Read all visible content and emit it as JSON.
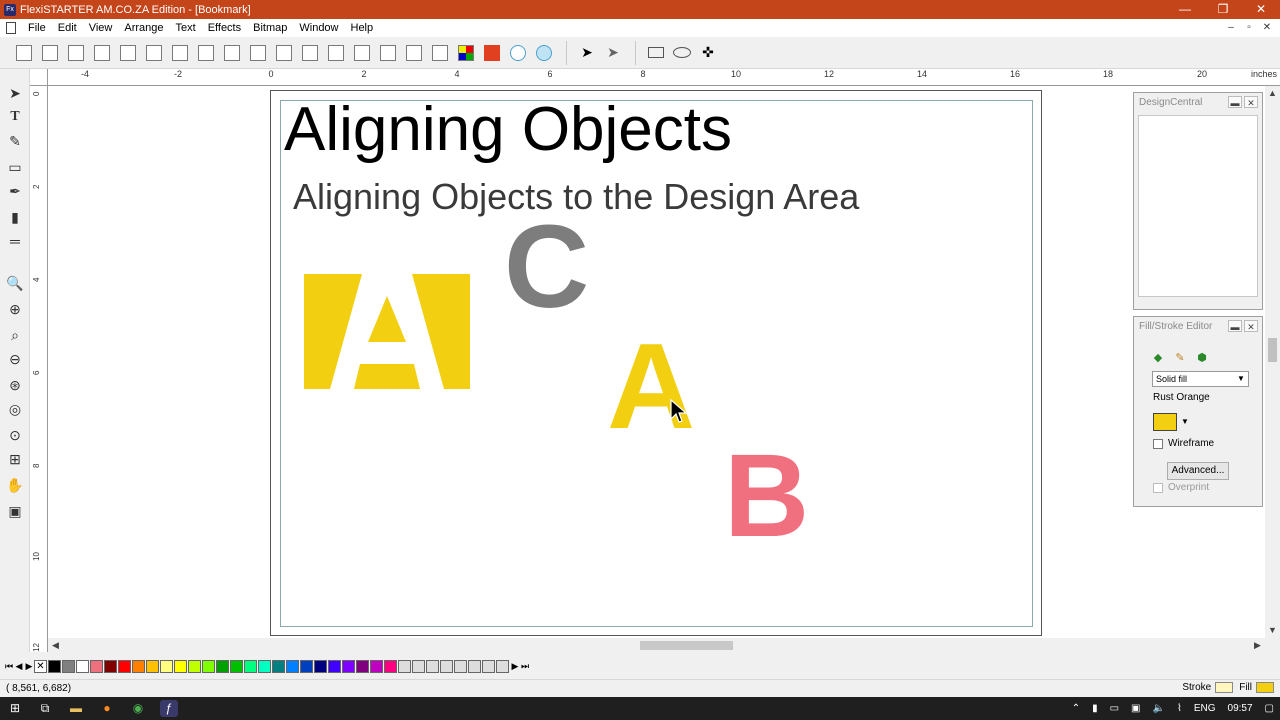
{
  "window": {
    "title": "FlexiSTARTER AM.CO.ZA Edition - [Bookmark]",
    "app_icon_text": "Fx",
    "minimize": "—",
    "maximize": "❐",
    "close": "✕"
  },
  "menu": {
    "items": [
      "File",
      "Edit",
      "View",
      "Arrange",
      "Text",
      "Effects",
      "Bitmap",
      "Window",
      "Help"
    ],
    "mdi_minimize": "–",
    "mdi_restore": "▫",
    "mdi_close": "✕"
  },
  "ruler": {
    "top_labels": [
      "-4",
      "-2",
      "0",
      "2",
      "4",
      "6",
      "8",
      "10",
      "12",
      "14",
      "16",
      "18",
      "20"
    ],
    "unit": "inches",
    "left_labels": [
      "0",
      "2",
      "4",
      "6",
      "8",
      "10",
      "12"
    ]
  },
  "canvas": {
    "heading": "Aligning Objects",
    "subheading": "Aligning Objects to the Design Area",
    "letters": [
      {
        "name": "letter-a-large",
        "text": "A",
        "color": "#f2cf10"
      },
      {
        "name": "letter-c",
        "text": "C",
        "color": "#7d7d7d"
      },
      {
        "name": "letter-a-small",
        "text": "A",
        "color": "#f2cf10"
      },
      {
        "name": "letter-b",
        "text": "B",
        "color": "#f07080"
      }
    ]
  },
  "design_central": {
    "title": "DesignCentral"
  },
  "fill_stroke": {
    "title": "Fill/Stroke Editor",
    "fill_type": "Solid fill",
    "color_name": "Rust Orange",
    "color": "#f2cf10",
    "wireframe_label": "Wireframe",
    "advanced_label": "Advanced...",
    "overprint_label": "Overprint"
  },
  "palette": {
    "colors": [
      "#000000",
      "#808080",
      "#ffffff",
      "#f07080",
      "#800000",
      "#ff0000",
      "#ff8000",
      "#ffc000",
      "#ffff80",
      "#ffff00",
      "#c0ff00",
      "#80ff00",
      "#00a000",
      "#00c000",
      "#00ff80",
      "#00ffc0",
      "#008080",
      "#0080ff",
      "#0040c0",
      "#000080",
      "#4000ff",
      "#8000ff",
      "#800080",
      "#c000c0",
      "#ff0080"
    ]
  },
  "status": {
    "coords": "(  8,561,    6,682)",
    "stroke_label": "Stroke",
    "stroke_color": "#fff6c0",
    "fill_label": "Fill",
    "fill_color": "#f2cf10"
  },
  "taskbar": {
    "language": "ENG",
    "time": "09:57"
  }
}
